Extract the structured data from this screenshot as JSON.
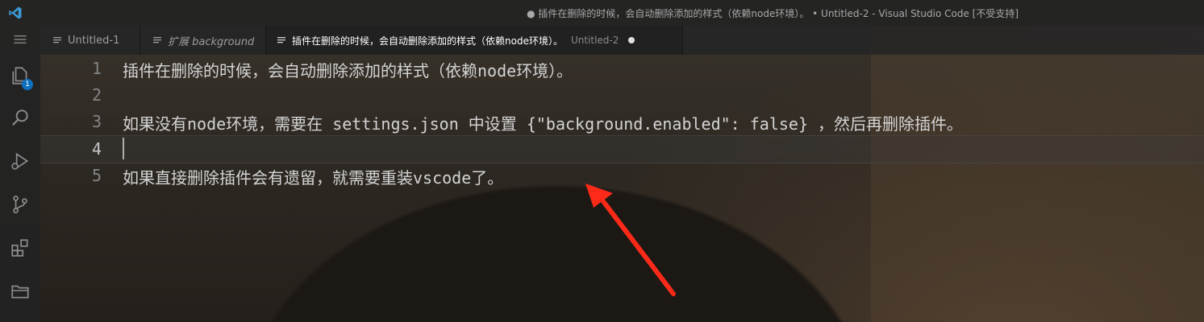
{
  "window": {
    "title": "● 插件在删除的时候，会自动删除添加的样式（依赖node环境）。 • Untitled-2 - Visual Studio Code [不受支持]"
  },
  "activity_bar": {
    "items": [
      {
        "icon": "explorer-icon",
        "badge": "1"
      },
      {
        "icon": "search-icon"
      },
      {
        "icon": "run-debug-icon"
      },
      {
        "icon": "source-control-icon"
      },
      {
        "icon": "extensions-icon"
      },
      {
        "icon": "folder-icon"
      }
    ],
    "menu_icon": "menu-icon"
  },
  "tabs": [
    {
      "label": "Untitled-1",
      "active": false,
      "italic": false
    },
    {
      "label": "扩展 background",
      "active": false,
      "italic": true
    },
    {
      "label": "插件在删除的时候，会自动删除添加的样式（依赖node环境）。",
      "description": "Untitled-2",
      "active": true,
      "dirty": true
    }
  ],
  "editor": {
    "current_line": 4,
    "lines": [
      {
        "number": "1",
        "text": "插件在删除的时候，会自动删除添加的样式（依赖node环境）。"
      },
      {
        "number": "2",
        "text": ""
      },
      {
        "number": "3",
        "text": "如果没有node环境，需要在 settings.json 中设置 {\"background.enabled\": false} ，然后再删除插件。"
      },
      {
        "number": "4",
        "text": ""
      },
      {
        "number": "5",
        "text": "如果直接删除插件会有遗留，就需要重装vscode了。"
      }
    ]
  },
  "colors": {
    "accent": "#0e70c0",
    "annotation_arrow": "#ff2a1a",
    "vscode_logo": "#3c99d4"
  }
}
